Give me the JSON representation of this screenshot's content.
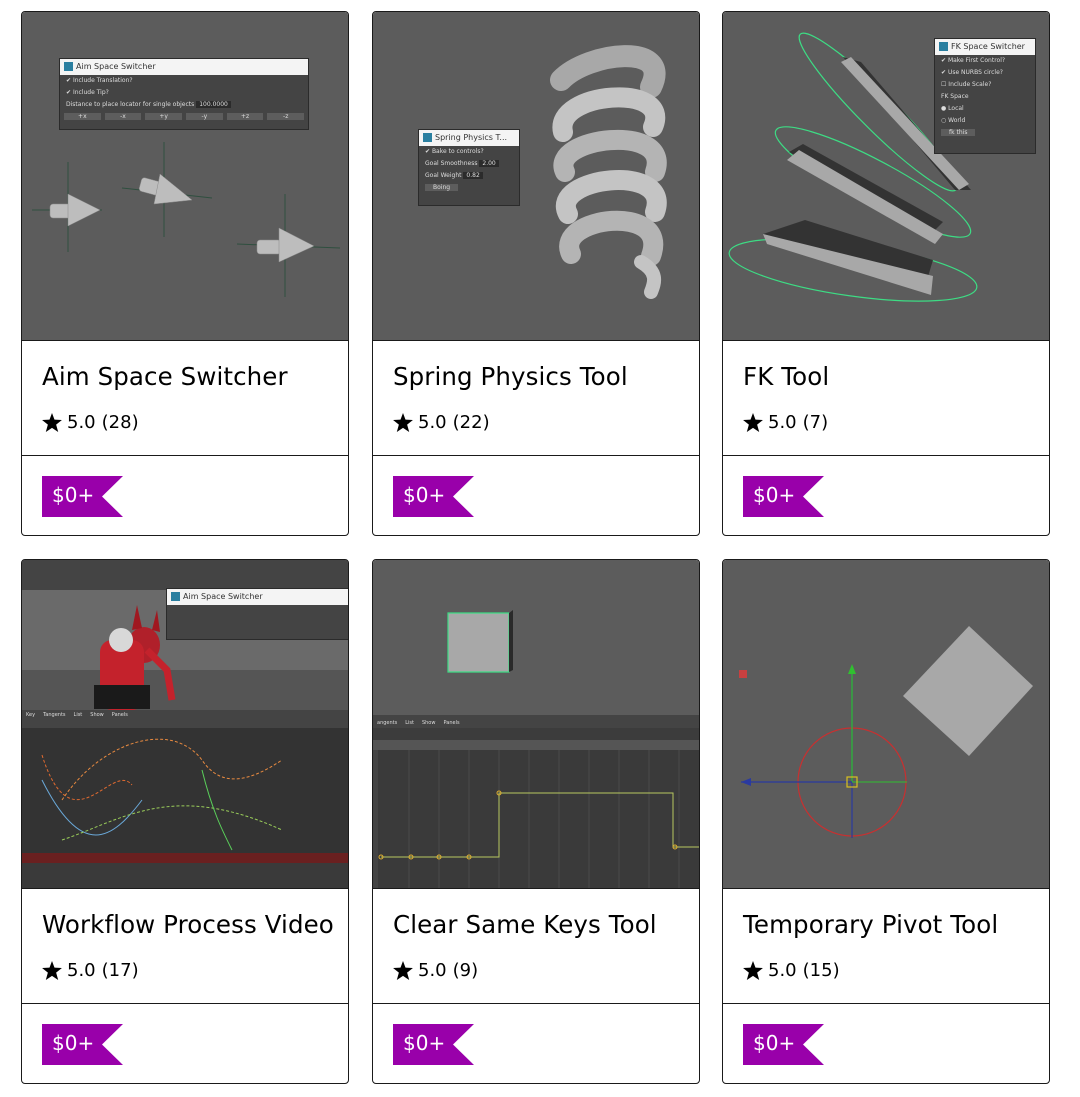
{
  "products": [
    {
      "title": "Aim Space Switcher",
      "rating": "5.0",
      "count": "(28)",
      "price": "$0+",
      "thumb": {
        "window_title": "Aim Space Switcher",
        "options": [
          "Include Translation?",
          "Include Tip?"
        ],
        "field_label": "Distance to place locator for single objects",
        "field_value": "100.0000",
        "buttons": [
          "+x",
          "-x",
          "+y",
          "-y",
          "+z",
          "-z"
        ]
      }
    },
    {
      "title": "Spring Physics Tool",
      "rating": "5.0",
      "count": "(22)",
      "price": "$0+",
      "thumb": {
        "window_title": "Spring Physics T...",
        "option": "Bake to controls?",
        "fields": [
          {
            "label": "Goal Smoothness",
            "value": "2.00"
          },
          {
            "label": "Goal Weight",
            "value": "0.82"
          }
        ],
        "button": "Boing"
      }
    },
    {
      "title": "FK Tool",
      "rating": "5.0",
      "count": "(7)",
      "price": "$0+",
      "thumb": {
        "window_title": "FK Space Switcher",
        "options": [
          "Make First Control?",
          "Use NURBS circle?",
          "Include Scale?"
        ],
        "space_label": "FK Space",
        "radios": [
          "Local",
          "World"
        ],
        "button": "fk this"
      }
    },
    {
      "title": "Workflow Process Video",
      "rating": "5.0",
      "count": "(17)",
      "price": "$0+",
      "thumb": {
        "window_title": "Aim Space Switcher",
        "menu": [
          "Key",
          "Tangents",
          "List",
          "Show",
          "Panels"
        ]
      }
    },
    {
      "title": "Clear Same Keys Tool",
      "rating": "5.0",
      "count": "(9)",
      "price": "$0+",
      "thumb": {
        "menu": [
          "angents",
          "List",
          "Show",
          "Panels"
        ]
      }
    },
    {
      "title": "Temporary Pivot Tool",
      "rating": "5.0",
      "count": "(15)",
      "price": "$0+",
      "thumb": {}
    }
  ],
  "colors": {
    "price_tag": "#90a",
    "viewport": "#5c5c5c",
    "border": "#1a1a1a",
    "nurbs_green": "#3ddc84"
  }
}
